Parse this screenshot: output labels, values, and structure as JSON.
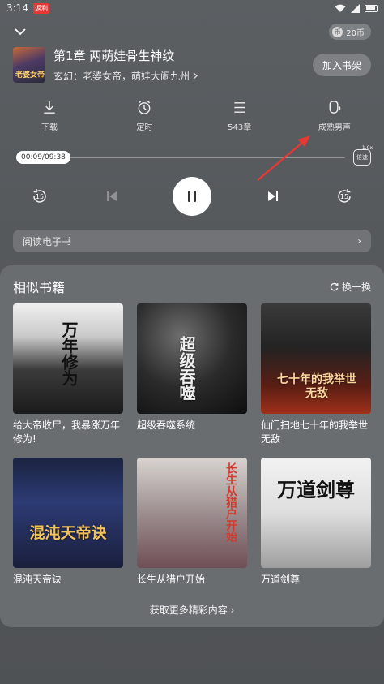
{
  "status": {
    "time": "3:14",
    "app_badge": "返利"
  },
  "topbar": {
    "coins": "20币",
    "coin_symbol": "币"
  },
  "book": {
    "chapter_title": "第1章 两萌娃骨生神纹",
    "genre_line": "玄幻：老婆女帝，萌娃大闹九州",
    "add_shelf": "加入书架",
    "cover_text": "老婆女帝"
  },
  "actions": [
    {
      "label": "下载",
      "icon": "download-icon"
    },
    {
      "label": "定时",
      "icon": "timer-icon"
    },
    {
      "label": "543章",
      "icon": "chapter-list-icon"
    },
    {
      "label": "成熟男声",
      "icon": "voice-icon"
    }
  ],
  "player": {
    "time": "00:09/09:38",
    "progress_fraction": 0.016,
    "speed_label": "倍速",
    "speed_value": "1.0x",
    "rewind_seconds": "15",
    "forward_seconds": "15"
  },
  "ebook": {
    "label": "阅读电子书",
    "chevron": "›"
  },
  "similar": {
    "title": "相似书籍",
    "refresh": "换一换",
    "books": [
      {
        "title": "给大帝收尸，我暴涨万年修为!",
        "cover_text": "万年修为"
      },
      {
        "title": "超级吞噬系统",
        "cover_text": "超级吞噬"
      },
      {
        "title": "仙门扫地七十年的我举世无敌",
        "cover_text": "七十年的我举世无敌"
      },
      {
        "title": "混沌天帝诀",
        "cover_text": "混沌天帝诀"
      },
      {
        "title": "长生从猎户开始",
        "cover_text": "长生从猎户开始"
      },
      {
        "title": "万道剑尊",
        "cover_text": "万道剑尊"
      }
    ],
    "more": "获取更多精彩内容 ›"
  },
  "colors": {
    "accent_arrow": "#e53935",
    "panel": "#6a6d70"
  }
}
